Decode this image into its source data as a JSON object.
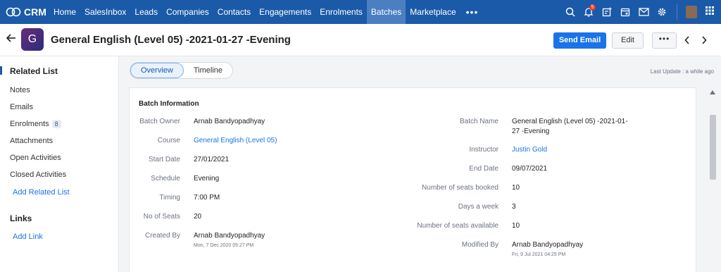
{
  "nav": {
    "app_name": "CRM",
    "items": [
      "Home",
      "SalesInbox",
      "Leads",
      "Companies",
      "Contacts",
      "Engagements",
      "Enrolments",
      "Batches",
      "Marketplace"
    ],
    "active_index": 7,
    "more": "•••",
    "notification_count": "5",
    "icons": [
      "search-icon",
      "bell-icon",
      "add-activity-icon",
      "calendar-icon",
      "mail-icon",
      "gear-icon",
      "user-avatar",
      "apps-grid-icon"
    ],
    "colors": {
      "bar": "#1b5aa8",
      "active": "#4b7fc2",
      "badge": "#e53935"
    }
  },
  "record": {
    "avatar_letter": "G",
    "title": "General English (Level 05) -2021-01-27 -Evening",
    "send_email_label": "Send Email",
    "edit_label": "Edit",
    "more_label": "•••"
  },
  "sidebar": {
    "related_heading": "Related List",
    "items": [
      {
        "label": "Notes"
      },
      {
        "label": "Emails"
      },
      {
        "label": "Enrolments",
        "count": "8"
      },
      {
        "label": "Attachments"
      },
      {
        "label": "Open Activities"
      },
      {
        "label": "Closed Activities"
      }
    ],
    "add_related": "Add Related List",
    "links_heading": "Links",
    "add_link": "Add Link"
  },
  "tabs": {
    "overview": "Overview",
    "timeline": "Timeline",
    "active": "Overview"
  },
  "last_update": "Last Update : a while ago",
  "batch_info": {
    "title": "Batch Information",
    "left": [
      {
        "label": "Batch Owner",
        "value": "Arnab Bandyopadhyay"
      },
      {
        "label": "Course",
        "value": "General English (Level 05)",
        "link": true
      },
      {
        "label": "Start Date",
        "value": "27/01/2021"
      },
      {
        "label": "Schedule",
        "value": "Evening"
      },
      {
        "label": "Timing",
        "value": "7:00 PM"
      },
      {
        "label": "No of Seats",
        "value": "20"
      },
      {
        "label": "Created By",
        "value": "Arnab Bandyopadhyay",
        "sub": "Mon, 7 Dec 2020 05:27 PM"
      }
    ],
    "right": [
      {
        "label": "Batch Name",
        "value_line1": "General English (Level 05) -2021-01-",
        "value_line2": "27 -Evening"
      },
      {
        "label": "Instructor",
        "value": "Justin Gold",
        "link": true
      },
      {
        "label": "End Date",
        "value": "09/07/2021"
      },
      {
        "label": "Number of seats booked",
        "value": "10"
      },
      {
        "label": "Days a week",
        "value": "3"
      },
      {
        "label": "Number of seats available",
        "value": "10"
      },
      {
        "label": "Modified By",
        "value": "Arnab Bandyopadhyay",
        "sub": "Fri, 9 Jul 2021 04:25 PM"
      }
    ]
  }
}
